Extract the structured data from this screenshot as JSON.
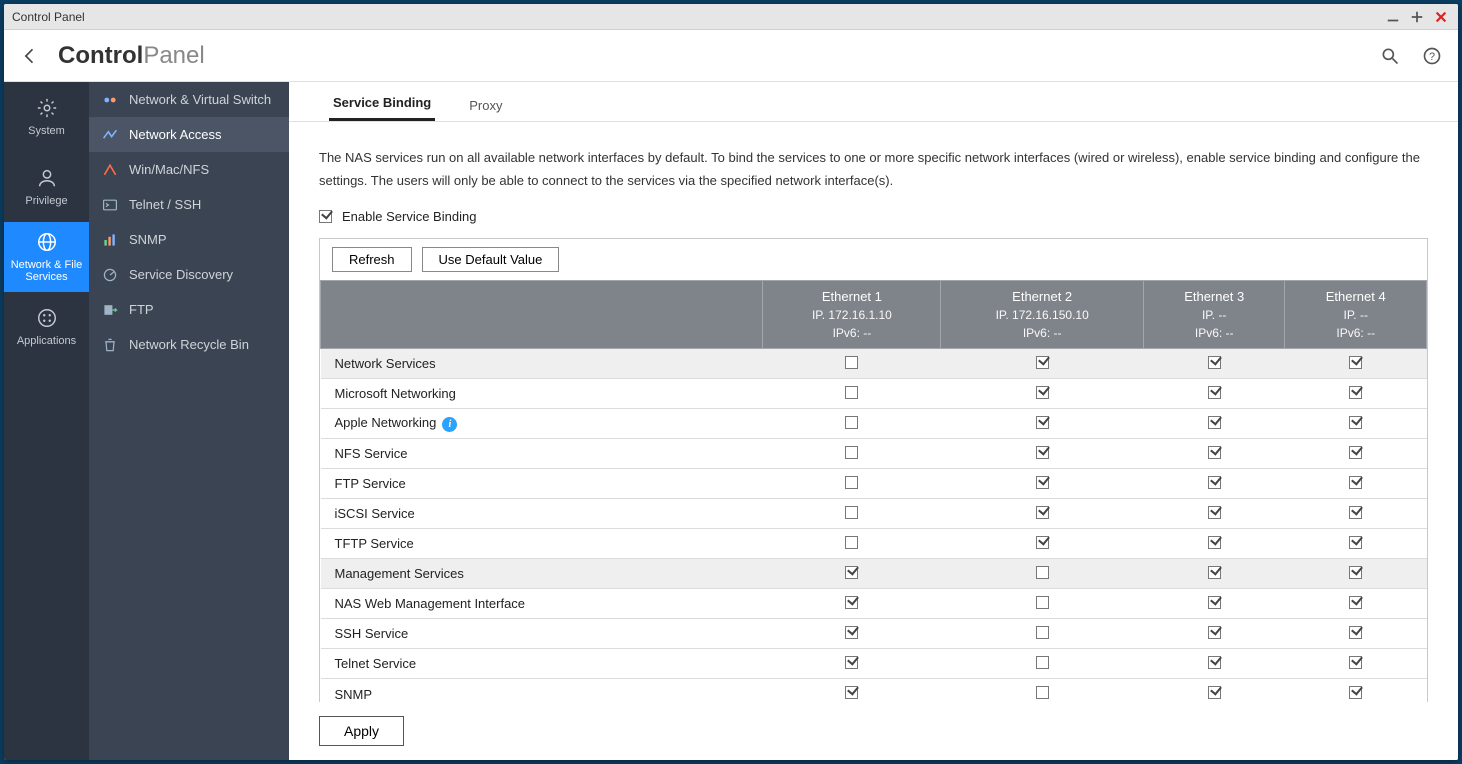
{
  "window": {
    "title": "Control Panel"
  },
  "header": {
    "crumb_bold": "Control",
    "crumb_light": "Panel"
  },
  "nav1": {
    "items": [
      {
        "label": "System",
        "icon": "gear-icon"
      },
      {
        "label": "Privilege",
        "icon": "user-icon"
      },
      {
        "label": "Network & File Services",
        "icon": "globe-icon",
        "active": true
      },
      {
        "label": "Applications",
        "icon": "apps-icon"
      }
    ]
  },
  "nav2": {
    "items": [
      {
        "label": "Network & Virtual Switch",
        "icon": "switch-icon"
      },
      {
        "label": "Network Access",
        "icon": "access-icon",
        "active": true
      },
      {
        "label": "Win/Mac/NFS",
        "icon": "winmac-icon"
      },
      {
        "label": "Telnet / SSH",
        "icon": "terminal-icon"
      },
      {
        "label": "SNMP",
        "icon": "bars-icon"
      },
      {
        "label": "Service Discovery",
        "icon": "radar-icon"
      },
      {
        "label": "FTP",
        "icon": "ftp-icon"
      },
      {
        "label": "Network Recycle Bin",
        "icon": "trash-icon"
      }
    ]
  },
  "tabs": [
    {
      "label": "Service Binding",
      "active": true
    },
    {
      "label": "Proxy"
    }
  ],
  "description": "The NAS services run on all available network interfaces by default. To bind the services to one or more specific network interfaces (wired or wireless), enable service binding and configure the settings. The users will only be able to connect to the services via the specified network interface(s).",
  "enable_label": "Enable Service Binding",
  "enable_checked": true,
  "toolbar": {
    "refresh": "Refresh",
    "default": "Use Default Value"
  },
  "columns": [
    {
      "name": "Ethernet 1",
      "ip": "IP. 172.16.1.10",
      "ipv6": "IPv6: --"
    },
    {
      "name": "Ethernet 2",
      "ip": "IP. 172.16.150.10",
      "ipv6": "IPv6: --"
    },
    {
      "name": "Ethernet 3",
      "ip": "IP. --",
      "ipv6": "IPv6: --"
    },
    {
      "name": "Ethernet 4",
      "ip": "IP. --",
      "ipv6": "IPv6: --"
    }
  ],
  "rows": [
    {
      "label": "Network Services",
      "section": true,
      "cells": [
        false,
        true,
        true,
        true
      ]
    },
    {
      "label": "Microsoft Networking",
      "cells": [
        false,
        true,
        true,
        true
      ]
    },
    {
      "label": "Apple Networking",
      "info": true,
      "cells": [
        false,
        true,
        true,
        true
      ]
    },
    {
      "label": "NFS Service",
      "cells": [
        false,
        true,
        true,
        true
      ]
    },
    {
      "label": "FTP Service",
      "cells": [
        false,
        true,
        true,
        true
      ]
    },
    {
      "label": "iSCSI Service",
      "cells": [
        false,
        true,
        true,
        true
      ]
    },
    {
      "label": "TFTP Service",
      "cells": [
        false,
        true,
        true,
        true
      ]
    },
    {
      "label": "Management Services",
      "section": true,
      "cells": [
        true,
        false,
        true,
        true
      ]
    },
    {
      "label": "NAS Web Management Interface",
      "cells": [
        true,
        false,
        true,
        true
      ]
    },
    {
      "label": "SSH Service",
      "cells": [
        true,
        false,
        true,
        true
      ]
    },
    {
      "label": "Telnet Service",
      "cells": [
        true,
        false,
        true,
        true
      ]
    },
    {
      "label": "SNMP",
      "cells": [
        true,
        false,
        true,
        true
      ]
    }
  ],
  "apply": "Apply"
}
